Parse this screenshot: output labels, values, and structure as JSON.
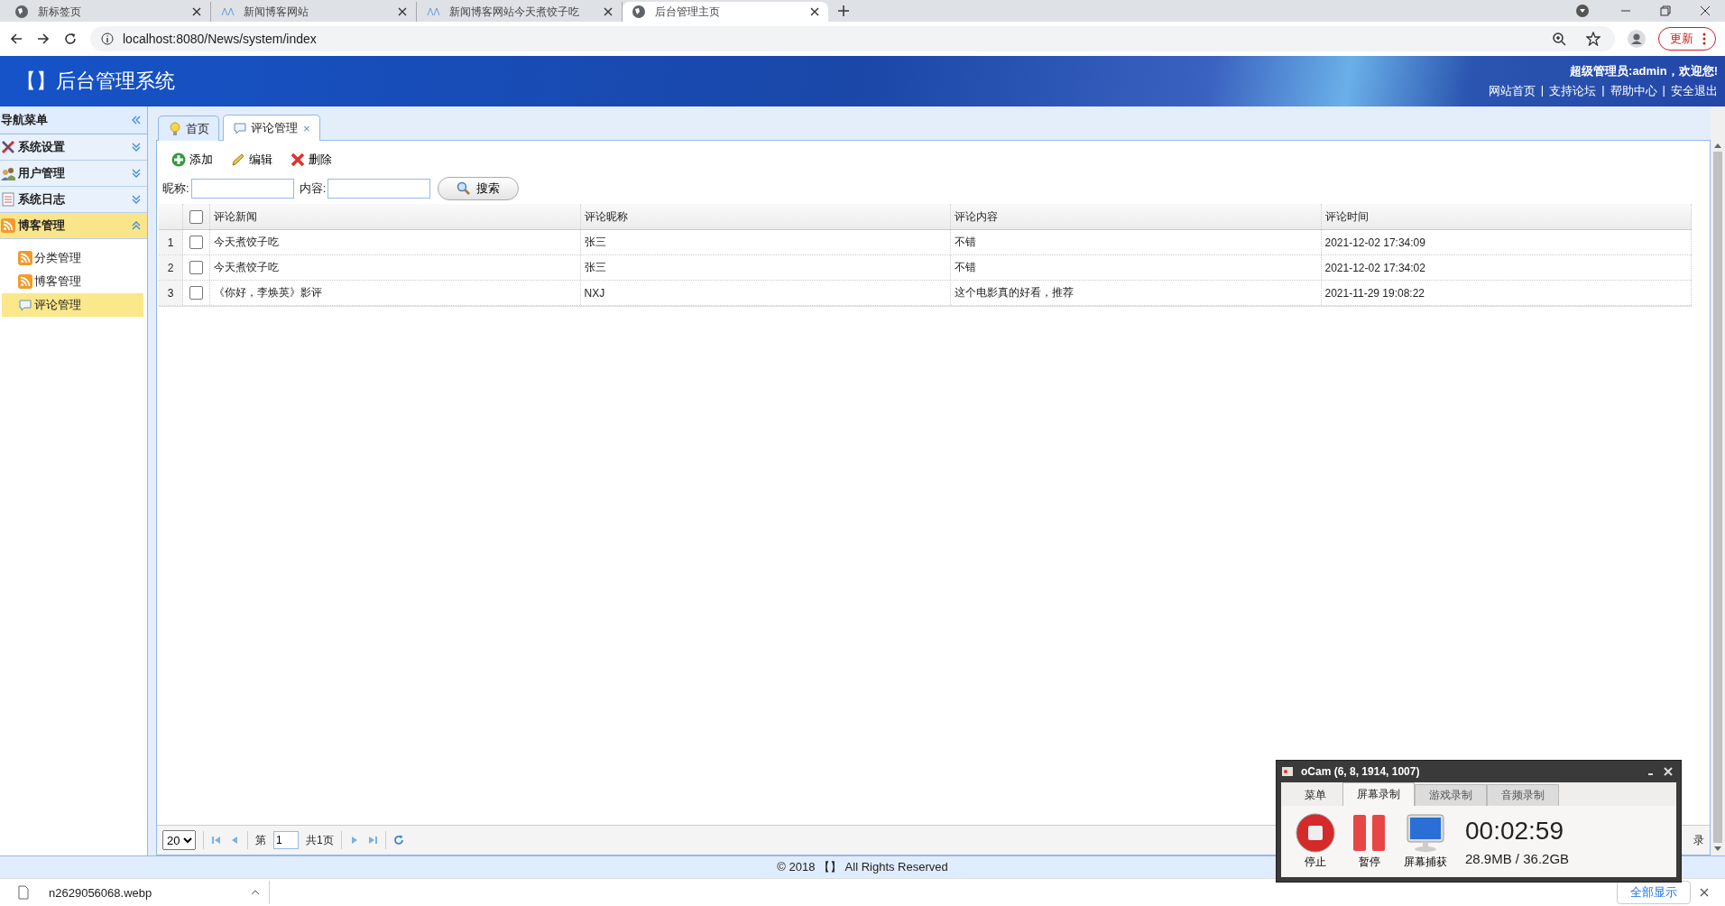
{
  "browser": {
    "tabs": [
      {
        "title": "新标签页",
        "kind": "globe",
        "selected": false
      },
      {
        "title": "新闻博客网站",
        "kind": "site",
        "selected": false
      },
      {
        "title": "新闻博客网站今天煮饺子吃",
        "kind": "site",
        "selected": false
      },
      {
        "title": "后台管理主页",
        "kind": "globe",
        "selected": true
      }
    ],
    "url": "localhost:8080/News/system/index",
    "update_button": "更新"
  },
  "header": {
    "title": "【】后台管理系统",
    "welcome": "超级管理员:admin，欢迎您!",
    "links": [
      "网站首页",
      "支持论坛",
      "帮助中心",
      "安全退出"
    ],
    "separator": "|"
  },
  "sidebar": {
    "title": "导航菜单",
    "groups": [
      {
        "label": "系统设置",
        "kind": "tools",
        "expanded": false
      },
      {
        "label": "用户管理",
        "kind": "users",
        "expanded": false
      },
      {
        "label": "系统日志",
        "kind": "log",
        "expanded": false
      },
      {
        "label": "博客管理",
        "kind": "rss",
        "expanded": true,
        "children": [
          {
            "label": "分类管理",
            "kind": "rss",
            "selected": false
          },
          {
            "label": "博客管理",
            "kind": "rss",
            "selected": false
          },
          {
            "label": "评论管理",
            "kind": "comment",
            "selected": true
          }
        ]
      }
    ]
  },
  "tabs": [
    {
      "label": "首页",
      "kind": "bulb",
      "selected": false
    },
    {
      "label": "评论管理",
      "kind": "comment",
      "selected": true,
      "close": "×"
    }
  ],
  "toolbar": [
    {
      "label": "添加",
      "kind": "add"
    },
    {
      "label": "编辑",
      "kind": "edit"
    },
    {
      "label": "删除",
      "kind": "delete"
    }
  ],
  "filters": [
    {
      "label": "昵称:"
    },
    {
      "label": "内容:"
    }
  ],
  "search_button": "搜索",
  "table": {
    "select_all_checked": false,
    "columns": [
      "评论新闻",
      "评论昵称",
      "评论内容",
      "评论时间"
    ],
    "rows": [
      {
        "number": "1",
        "checked": false,
        "cells": [
          "今天煮饺子吃",
          "张三",
          "不错",
          "2021-12-02 17:34:09"
        ]
      },
      {
        "number": "2",
        "checked": false,
        "cells": [
          "今天煮饺子吃",
          "张三",
          "不错",
          "2021-12-02 17:34:02"
        ]
      },
      {
        "number": "3",
        "checked": false,
        "cells": [
          "《你好，李焕英》影评",
          "NXJ",
          "这个电影真的好看，推荐",
          "2021-11-29 19:08:22"
        ]
      }
    ]
  },
  "pager": {
    "page_size": "20",
    "page_prefix": "第",
    "page": "1",
    "total": "共1页",
    "info": "录"
  },
  "footer": "© 2018 【】 All Rights Reserved",
  "downloads": {
    "file": "n2629056068.webp",
    "show_all": "全部显示"
  },
  "ocam": {
    "title": "oCam (6, 8, 1914, 1007)",
    "tabs": [
      {
        "label": "菜单",
        "selected": false
      },
      {
        "label": "屏幕录制",
        "selected": true
      },
      {
        "label": "游戏录制",
        "selected": false
      },
      {
        "label": "音频录制",
        "selected": false
      }
    ],
    "buttons": [
      {
        "label": "停止",
        "kind": "stop"
      },
      {
        "label": "暂停",
        "kind": "pause"
      },
      {
        "label": "屏幕捕获",
        "kind": "monitor"
      }
    ],
    "time": "00:02:59",
    "size": "28.9MB / 36.2GB"
  }
}
